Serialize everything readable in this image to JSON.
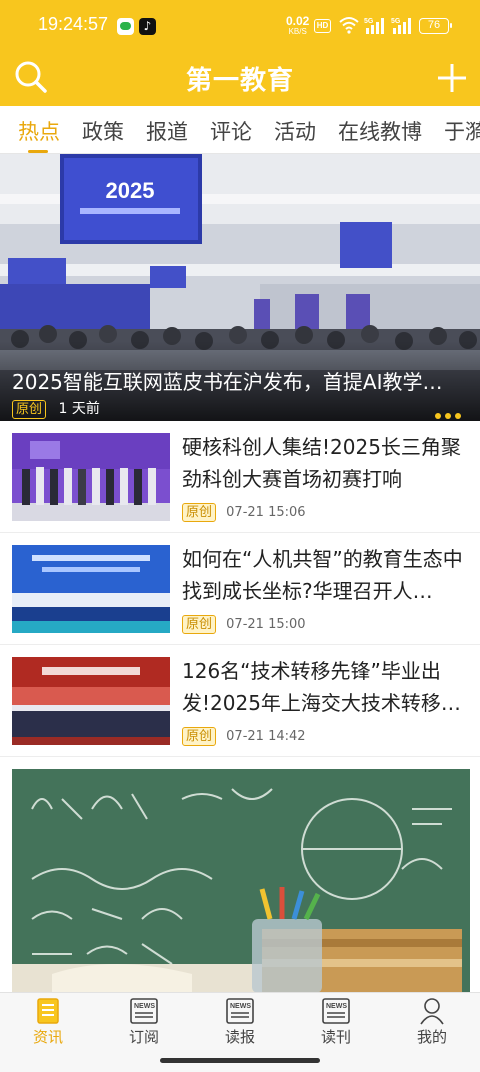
{
  "status_bar": {
    "time": "19:24:57",
    "net_speed": "0.02",
    "net_unit": "KB/S",
    "hd_label": "HD",
    "signal_1_label": "5G",
    "signal_2_label": "5G",
    "battery": "76"
  },
  "header": {
    "title": "第一教育",
    "search_icon": "search-icon",
    "add_icon": "plus-icon"
  },
  "tabs": [
    {
      "label": "热点",
      "active": true
    },
    {
      "label": "政策"
    },
    {
      "label": "报道"
    },
    {
      "label": "评论"
    },
    {
      "label": "活动"
    },
    {
      "label": "在线教博"
    },
    {
      "label": "于漪"
    }
  ],
  "hero": {
    "title": "2025智能互联网蓝皮书在沪发布，首提AI教学…",
    "badge": "原创",
    "time": "1 天前",
    "screen_text": "2025"
  },
  "news": [
    {
      "title": "硬核科创人集结!2025长三角聚劲科创大赛首场初赛打响",
      "badge": "原创",
      "time": "07-21 15:06"
    },
    {
      "title": "如何在“人机共智”的教育生态中找到成长坐标?华理召开人…",
      "badge": "原创",
      "time": "07-21 15:00"
    },
    {
      "title": "126名“技术转移先锋”毕业出发!2025年上海交大技术转移…",
      "badge": "原创",
      "time": "07-21 14:42"
    }
  ],
  "bottom_nav": [
    {
      "label": "资讯",
      "icon": "news-feed-icon",
      "active": true
    },
    {
      "label": "订阅",
      "icon": "newspaper-icon"
    },
    {
      "label": "读报",
      "icon": "newspaper-icon"
    },
    {
      "label": "读刊",
      "icon": "newspaper-icon"
    },
    {
      "label": "我的",
      "icon": "person-icon"
    }
  ],
  "colors": {
    "brand": "#F8C61E",
    "accent": "#E9A80D"
  }
}
